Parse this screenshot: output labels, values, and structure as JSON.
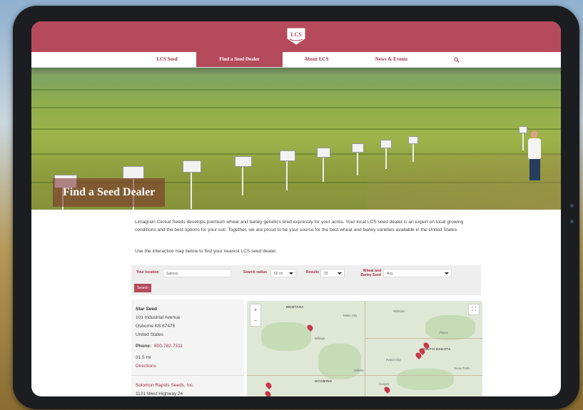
{
  "logo": {
    "text": "LCS"
  },
  "nav": {
    "items": [
      {
        "label": "LCS Seed"
      },
      {
        "label": "Find a Seed Dealer"
      },
      {
        "label": "About LCS"
      },
      {
        "label": "News & Events"
      }
    ],
    "search_icon": "search-icon"
  },
  "hero": {
    "title": "Find a Seed Dealer",
    "sign_text": "SEED LCS"
  },
  "intro": {
    "paragraph": "Limagrain Cereal Seeds develops premium wheat and barley genetics bred expressly for your acres. Your local LCS seed dealer is an expert on local growing conditions and the best options for your soil. Together, we are proud to be your source for the best wheat and barley varieties available in the United States.",
    "map_instruction": "Use the interactive map below to find your nearest LCS seed dealer."
  },
  "search": {
    "location_label": "Your location",
    "location_placeholder": "Salinas",
    "radius_label": "Search radius",
    "radius_value": "50 mi",
    "results_label": "Results",
    "results_value": "25",
    "crop_label": "Wheat and Barley Seed",
    "crop_value": "Any",
    "button": "Search"
  },
  "dealers": [
    {
      "name": "Star Seed",
      "address1": "101 Industrial Avenue",
      "address2": "Osborne KS 67476",
      "country": "United States",
      "phone_label": "Phone:",
      "phone": "800-782-7311",
      "distance": "31.5 mi",
      "directions": "Directions"
    },
    {
      "name": "Solomon Rapids Seeds, Inc.",
      "address1": "1131 West Highway 24"
    }
  ],
  "map": {
    "zoom_in": "+",
    "zoom_out": "−",
    "fullscreen": "⛶",
    "labels": {
      "montana": "MONTANA",
      "wyoming": "WYOMING",
      "south_dakota": "SOUTH DAKOTA",
      "miles_city": "Miles City",
      "billings": "Billings",
      "gillette": "Gillette",
      "casper": "Casper",
      "rapid_city": "Rapid City",
      "sioux_falls": "Sioux Falls",
      "pierre": "Pierre",
      "williston": "Williston"
    }
  },
  "colors": {
    "brand": "#b54a5b",
    "link": "#a3304a"
  }
}
